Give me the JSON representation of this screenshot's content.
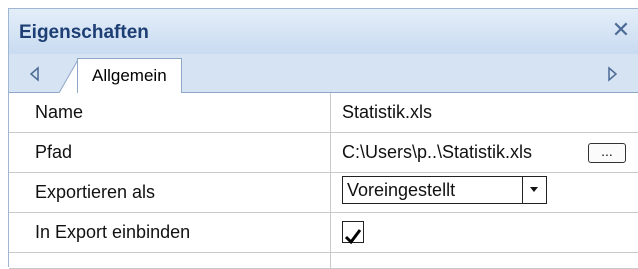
{
  "panel": {
    "title": "Eigenschaften",
    "close_icon": "close-icon"
  },
  "tabs": {
    "nav_left_icon": "triangle-left-icon",
    "nav_right_icon": "triangle-right-icon",
    "active": "Allgemein"
  },
  "properties": [
    {
      "name": "Name",
      "value": "Statistik.xls"
    },
    {
      "name": "Pfad",
      "value": "C:\\Users\\p..\\Statistik.xls",
      "button_label": "..."
    },
    {
      "name": "Exportieren als",
      "value": "Voreingestellt"
    },
    {
      "name": "In Export einbinden",
      "checked": true
    }
  ],
  "colors": {
    "title_text": "#1d3f74",
    "panel_background": "#d5e3f3",
    "grid_line": "#c9c9c9"
  }
}
